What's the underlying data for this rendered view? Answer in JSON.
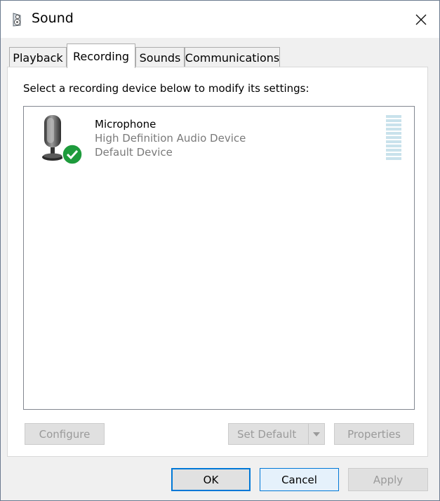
{
  "window": {
    "title": "Sound"
  },
  "tabs": [
    {
      "label": "Playback",
      "active": false
    },
    {
      "label": "Recording",
      "active": true
    },
    {
      "label": "Sounds",
      "active": false
    },
    {
      "label": "Communications",
      "active": false
    }
  ],
  "recording": {
    "instruction": "Select a recording device below to modify its settings:",
    "devices": [
      {
        "name": "Microphone",
        "description": "High Definition Audio Device",
        "status": "Default Device",
        "icon": "microphone-icon",
        "status_icon": "check-icon",
        "status_color": "#1e9b3c",
        "input_level": 0
      }
    ],
    "buttons": {
      "configure": "Configure",
      "set_default": "Set Default",
      "properties": "Properties"
    }
  },
  "footer": {
    "ok": "OK",
    "cancel": "Cancel",
    "apply": "Apply"
  },
  "colors": {
    "accent": "#0078d7",
    "level_meter": "#c9e2ec"
  }
}
